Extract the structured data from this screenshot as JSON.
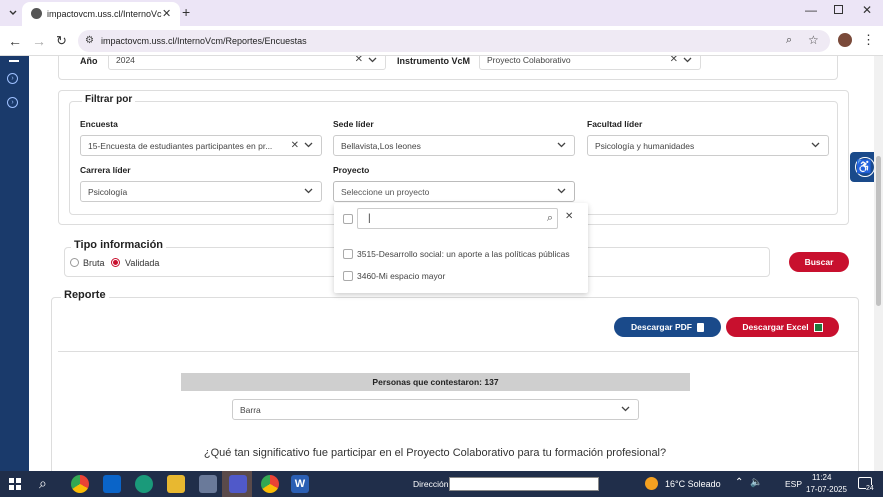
{
  "browser": {
    "tab_title": "impactovcm.uss.cl/InternoVcm/",
    "url": "impactovcm.uss.cl/InternoVcm/Reportes/Encuestas"
  },
  "top_filters": {
    "anio_label": "Año",
    "anio_value": "2024",
    "instrumento_label": "Instrumento VcM",
    "instrumento_value": "Proyecto Colaborativo"
  },
  "filtrar": {
    "title": "Filtrar por",
    "encuesta_label": "Encuesta",
    "encuesta_value": "15-Encuesta de estudiantes participantes en pr...",
    "sede_label": "Sede líder",
    "sede_value": "Bellavista,Los leones",
    "facultad_label": "Facultad líder",
    "facultad_value": "Psicología y humanidades",
    "carrera_label": "Carrera líder",
    "carrera_value": "Psicología",
    "proyecto_label": "Proyecto",
    "proyecto_placeholder": "Seleccione un proyecto"
  },
  "dropdown": {
    "search_value": "|",
    "options": [
      "3515-Desarrollo social: un aporte a las políticas públicas",
      "3460-Mi espacio mayor"
    ]
  },
  "tipo": {
    "title": "Tipo información",
    "bruta": "Bruta",
    "validada": "Validada",
    "buscar": "Buscar"
  },
  "reporte": {
    "title": "Reporte",
    "pdf": "Descargar PDF",
    "excel": "Descargar Excel",
    "personas": "Personas que contestaron: 137",
    "chart_type": "Barra",
    "question": "¿Qué tan significativo fue participar en el Proyecto Colaborativo para tu formación profesional?"
  },
  "taskbar": {
    "direccion": "Dirección",
    "weather": "16°C  Soleado",
    "lang": "ESP",
    "time": "11:24",
    "date": "17-07-2025",
    "badge": "24"
  },
  "colors": {
    "accent": "#c8102e",
    "navy": "#1a4a8a",
    "sidebar": "#1a3a6b"
  }
}
